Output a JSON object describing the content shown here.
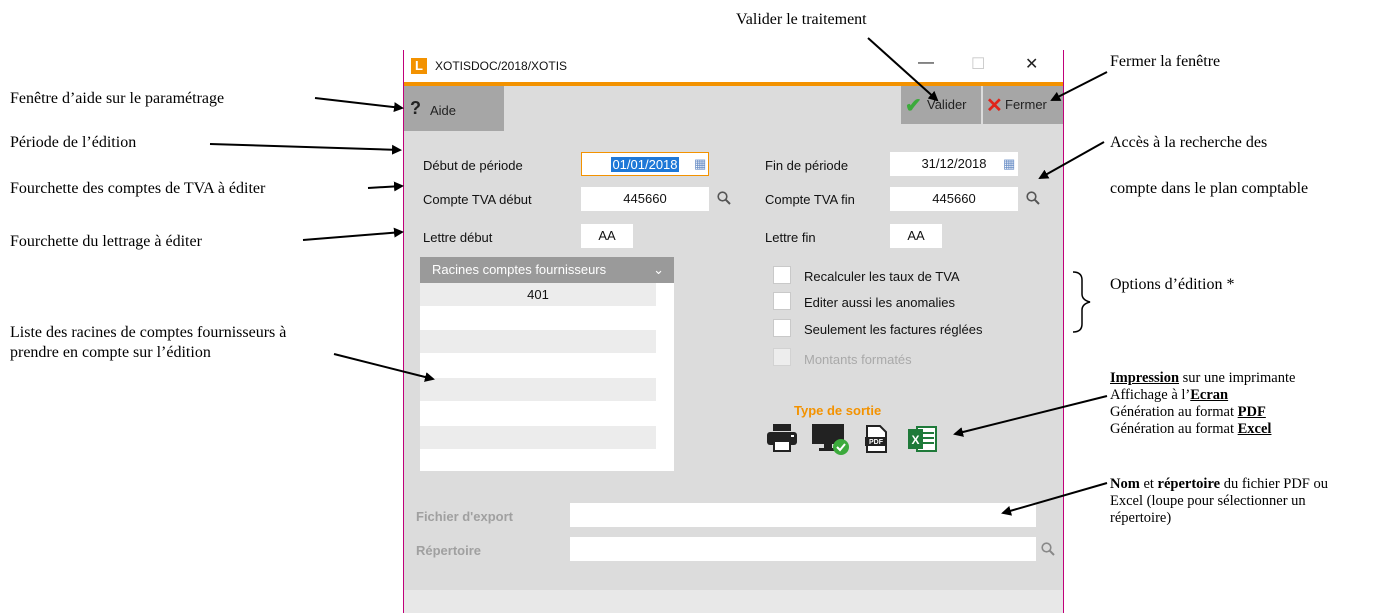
{
  "annotations": {
    "valider": "Valider le traitement",
    "fermer": "Fermer la fenêtre",
    "aide": "Fenêtre d’aide sur le paramétrage",
    "periode": "Période de l’édition",
    "tva": "Fourchette des comptes de TVA à éditer",
    "lettrage": "Fourchette du lettrage à éditer",
    "recherche_1": "Accès à la recherche des",
    "recherche_2": "compte dans le plan comptable",
    "options": "Options d’édition *",
    "liste_1": "Liste des racines de comptes fournisseurs à",
    "liste_2": "prendre en compte sur l’édition",
    "sortie": {
      "l1_bold": "Impression",
      "l1_rest": " sur une imprimante",
      "l2_pre": "Affichage à l’",
      "l2_bold": "Ecran",
      "l3_pre": "Génération au format ",
      "l3_bold": "PDF",
      "l4_pre": "Génération au format ",
      "l4_bold": "Excel"
    },
    "fichier": {
      "bold1": "Nom",
      "mid": " et ",
      "bold2": "répertoire",
      "rest1": " du fichier PDF ou",
      "line2": "Excel (loupe pour sélectionner un",
      "line3": "répertoire)"
    }
  },
  "window": {
    "logo": "L",
    "title": "XOTISDOC/2018/XOTIS",
    "minimize": "—",
    "maximize": "☐",
    "close": "✕"
  },
  "toolbar": {
    "aide_icon": "?",
    "aide_label": "Aide",
    "valider_label": "Valider",
    "fermer_label": "Fermer"
  },
  "form": {
    "debut_periode_label": "Début de période",
    "debut_periode_value": "01/01/2018",
    "fin_periode_label": "Fin de période",
    "fin_periode_value": "31/12/2018",
    "compte_tva_debut_label": "Compte TVA début",
    "compte_tva_debut_value": "445660",
    "compte_tva_fin_label": "Compte TVA fin",
    "compte_tva_fin_value": "445660",
    "lettre_debut_label": "Lettre début",
    "lettre_debut_value": "AA",
    "lettre_fin_label": "Lettre fin",
    "lettre_fin_value": "AA"
  },
  "list": {
    "header": "Racines comptes fournisseurs",
    "rows": [
      "401"
    ]
  },
  "options": {
    "recalculer": "Recalculer les taux de TVA",
    "anomalies": "Editer aussi les anomalies",
    "reglees": "Seulement les factures réglées",
    "montants": "Montants formatés"
  },
  "sortie": {
    "title": "Type de sortie",
    "icons": [
      "printer-icon",
      "screen-icon",
      "pdf-icon",
      "excel-icon"
    ]
  },
  "export": {
    "fichier_label": "Fichier d'export",
    "fichier_value": "",
    "repertoire_label": "Répertoire",
    "repertoire_value": ""
  },
  "colors": {
    "accent": "#f39200",
    "border": "#c0007a",
    "valider": "#3caa3c",
    "fermer": "#e0241b"
  }
}
